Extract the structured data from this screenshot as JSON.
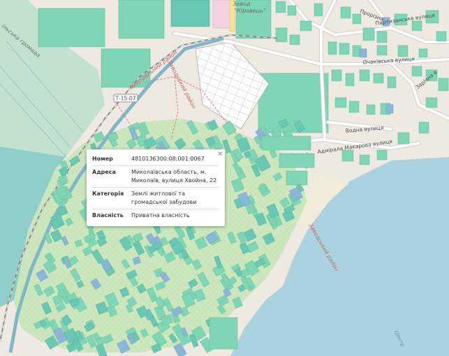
{
  "map_labels": {
    "top_area_line1": "Завод",
    "top_area_line2": "\"Кіровець\"",
    "prorizna": "Прорізна",
    "partyzanska": "Партизанська вулиця",
    "ochakivska": "Очаківська вулиця",
    "zarichna": "Зарічна в",
    "vodna": "Водна вулиця",
    "makarova": "Адмірала Макарова вулиця",
    "tsentralnyi_raion": "Центральний район",
    "zavodskyi_raion_left": "Заводський район",
    "zavodskyi_raion_right": "Заводський район",
    "highway_ref": "Т-15-07",
    "hromada_left": "ільська громада",
    "centre_bottom": "Центр"
  },
  "colors": {
    "background": "#efeae1",
    "water": "#aad3df",
    "parcel": "#7fd6b4",
    "parcel_alt": "#69c8b4",
    "parcel_blue": "#8ab7d8",
    "green_area": "#cfe8c0",
    "road": "#ffffff",
    "road_casing": "#d4d0c8",
    "railway": "#8a8a8a",
    "boundary": "#d88a8a",
    "highway": "#7fb7c8"
  },
  "popup": {
    "close_label": "×",
    "rows": [
      {
        "key": "Номер",
        "value": "4810136300:08:001:0067"
      },
      {
        "key": "Адреса",
        "value": "Миколаївська область, м. Миколаїв, вулиця Хвойна, 22"
      },
      {
        "key": "Категорія",
        "value": "Землі житлової та громадської забудови"
      },
      {
        "key": "Власність",
        "value": "Приватна власність"
      }
    ]
  }
}
